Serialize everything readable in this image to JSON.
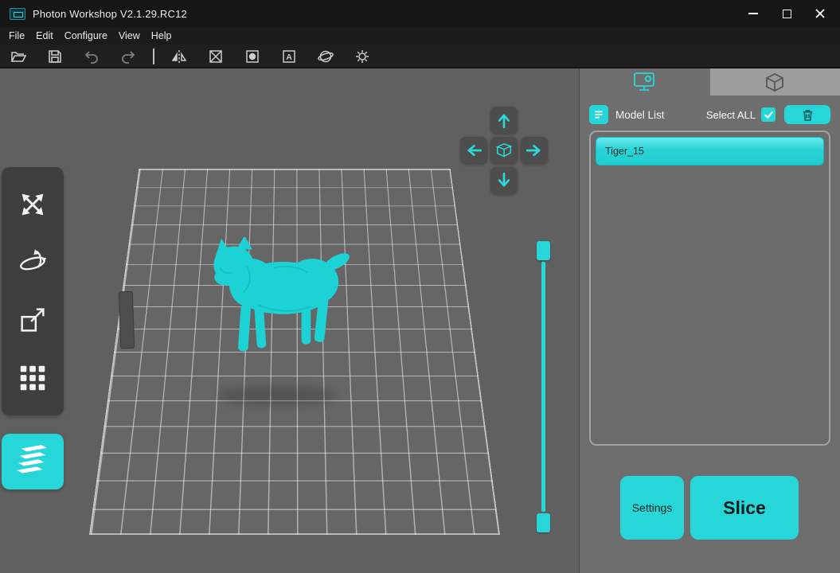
{
  "colors": {
    "accent": "#27d6d8",
    "accent_dark": "#0a5c5e",
    "panel": "#6e6e6e",
    "viewport": "#606060",
    "chrome": "#1a1a1a",
    "model": "#1dd2d4"
  },
  "window": {
    "title": "Photon Workshop V2.1.29.RC12"
  },
  "menu": {
    "items": [
      {
        "label": "File"
      },
      {
        "label": "Edit"
      },
      {
        "label": "Configure"
      },
      {
        "label": "View"
      },
      {
        "label": "Help"
      }
    ]
  },
  "toolbar": {
    "icons": [
      {
        "name": "open"
      },
      {
        "name": "save"
      },
      {
        "name": "undo"
      },
      {
        "name": "redo"
      },
      {
        "name": "mirror"
      },
      {
        "name": "frame-x"
      },
      {
        "name": "frame-dot"
      },
      {
        "name": "text"
      },
      {
        "name": "sphere"
      },
      {
        "name": "gear-sync"
      }
    ]
  },
  "left_tools": {
    "items": [
      {
        "name": "move"
      },
      {
        "name": "rotate"
      },
      {
        "name": "scale"
      },
      {
        "name": "clone-array"
      }
    ],
    "layers": {
      "name": "layer-preview"
    }
  },
  "nav_pad": {
    "buttons": [
      "up",
      "left",
      "home-cube",
      "right",
      "down"
    ]
  },
  "right_panel": {
    "tabs": [
      {
        "name": "model-settings",
        "active": true
      },
      {
        "name": "slice-preview",
        "active": false
      }
    ],
    "model_list": {
      "title": "Model List",
      "select_all": "Select ALL",
      "checked": true,
      "items": [
        {
          "name": "Tiger_15",
          "selected": true
        }
      ]
    },
    "settings_button": "Settings",
    "slice_button": "Slice"
  }
}
